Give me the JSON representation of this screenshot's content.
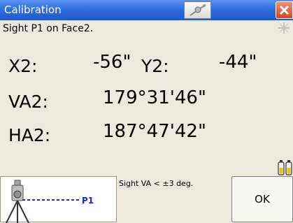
{
  "window": {
    "title": "Calibration",
    "icons": [
      "crosshair-status-icon",
      "close-icon",
      "sparkle-icon",
      "battery-icon",
      "total-station-icon"
    ]
  },
  "instruction": "Sight P1 on Face2.",
  "readings": {
    "x2": {
      "label": "X2:",
      "value": "-56\""
    },
    "y2": {
      "label": "Y2:",
      "value": "-44\""
    },
    "va2": {
      "label": "VA2:",
      "value": "179°31'46\""
    },
    "ha2": {
      "label": "HA2:",
      "value": "187°47'42\""
    }
  },
  "target": {
    "label": "P1"
  },
  "note": "Sight VA < ±3 deg.",
  "buttons": {
    "ok": "OK"
  },
  "colors": {
    "titlebar": "#2f6ee0",
    "background": "#eceadd",
    "target_line": "#1d28b8",
    "close": "#d6432a"
  }
}
